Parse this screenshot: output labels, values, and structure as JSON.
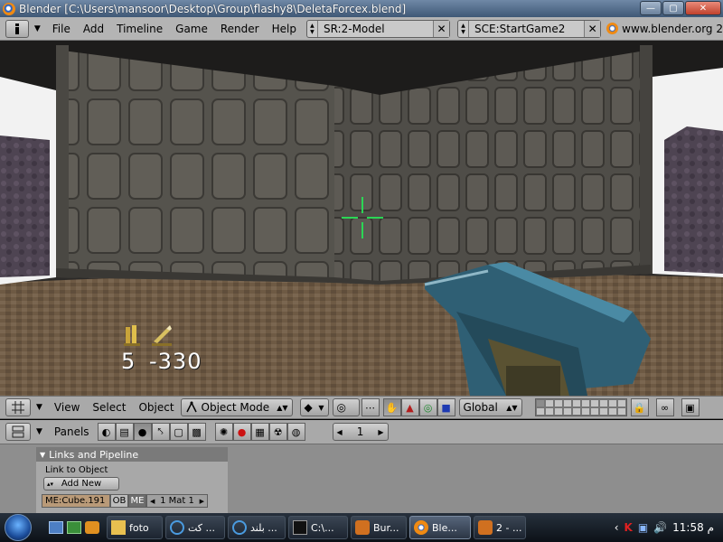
{
  "window": {
    "title": "Blender [C:\\Users\\mansoor\\Desktop\\Group\\flashy8\\DeletaForcex.blend]",
    "controls": {
      "minimize": "—",
      "maximize": "▢",
      "close": "✕"
    }
  },
  "main_header": {
    "menus": [
      "File",
      "Add",
      "Timeline",
      "Game",
      "Render",
      "Help"
    ],
    "screen_field": "SR:2-Model",
    "scene_field": "SCE:StartGame2",
    "url": "www.blender.org 2"
  },
  "game_hud": {
    "ammo_count": "5",
    "ammo_reserve": "-330"
  },
  "view_header": {
    "menus": [
      "View",
      "Select",
      "Object"
    ],
    "mode": "Object Mode",
    "orientation": "Global"
  },
  "buttons_header": {
    "panels_label": "Panels",
    "frame_value": "1"
  },
  "panel": {
    "title": "Links and Pipeline",
    "link_to_object": "Link to Object",
    "add_new": "Add New",
    "mesh_name": "ME:Cube.191",
    "ob_label": "OB",
    "me_label": "ME",
    "material": "1 Mat 1"
  },
  "taskbar": {
    "items": [
      "foto",
      "كت ...",
      "بلند ...",
      "C:\\...",
      "Bur...",
      "Ble...",
      "2 - ..."
    ],
    "clock": "11:58 م"
  },
  "colors": {
    "crosshair": "#2bd655",
    "blender_header": "#b4b4b4",
    "panel_head": "#7a7a7a"
  }
}
